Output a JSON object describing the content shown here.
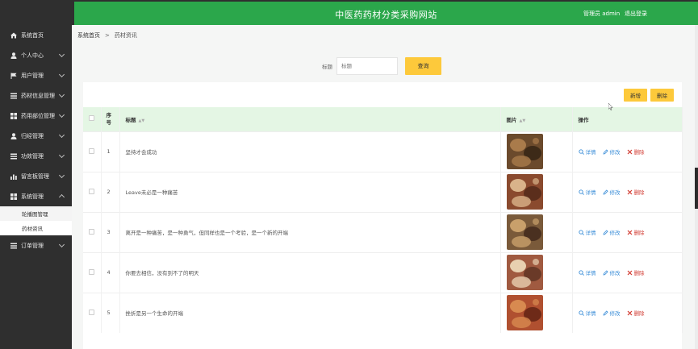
{
  "app": {
    "title": "中医药药材分类采购网站",
    "user_text": "管理员 admin",
    "logout": "退出登录"
  },
  "sidebar": {
    "items": [
      {
        "label": "系统首页",
        "icon": "home-icon"
      },
      {
        "label": "个人中心",
        "icon": "user-icon"
      },
      {
        "label": "用户管理",
        "icon": "flag-icon"
      },
      {
        "label": "药材信息管理",
        "icon": "list-icon"
      },
      {
        "label": "药用部位管理",
        "icon": "grid-icon"
      },
      {
        "label": "归经管理",
        "icon": "user-icon"
      },
      {
        "label": "功效管理",
        "icon": "list-icon"
      },
      {
        "label": "留言板管理",
        "icon": "chart-icon"
      },
      {
        "label": "系统管理",
        "icon": "grid-icon"
      }
    ],
    "sub_items": [
      {
        "label": "轮播图管理"
      },
      {
        "label": "药材资讯"
      }
    ],
    "last_item": {
      "label": "订单管理",
      "icon": "list-icon"
    }
  },
  "breadcrumb": {
    "home": "系统首页",
    "separator": ">",
    "current": "药材资讯"
  },
  "search": {
    "label": "标题",
    "placeholder": "标题",
    "button": "查询"
  },
  "actions": {
    "add": "新增",
    "delete": "删除"
  },
  "table": {
    "headers": {
      "index": "序号",
      "title": "标题",
      "image": "图片",
      "operations": "操作"
    },
    "op_labels": {
      "view": "详情",
      "edit": "修改",
      "delete": "删除"
    },
    "rows": [
      {
        "index": "1",
        "title": "坚持才会成功"
      },
      {
        "index": "2",
        "title": "Leave未必是一种痛苦"
      },
      {
        "index": "3",
        "title": "离开是一种痛苦，是一种勇气，但同样也是一个考验，是一个新的开端"
      },
      {
        "index": "4",
        "title": "你要去相信，没有到不了的明天"
      },
      {
        "index": "5",
        "title": "挫折是另一个生命的开端"
      }
    ]
  },
  "colors": {
    "header_green": "#2ba74b",
    "sidebar_dark": "#2f2f2f",
    "button_yellow": "#fdc93b",
    "table_head": "#e4f6e4",
    "delete_red": "#d23b32",
    "link_blue": "#3b8ed8"
  }
}
